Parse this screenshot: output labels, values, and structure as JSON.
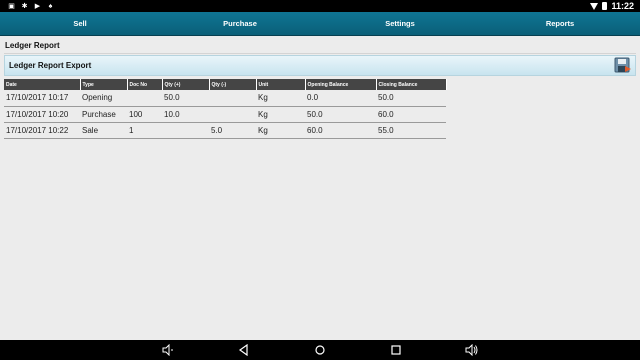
{
  "status": {
    "time": "11:22"
  },
  "tabs": [
    {
      "label": "Sell"
    },
    {
      "label": "Purchase"
    },
    {
      "label": "Settings"
    },
    {
      "label": "Reports"
    }
  ],
  "page": {
    "title": "Ledger Report",
    "export_label": "Ledger Report Export"
  },
  "table": {
    "headers": [
      "Date",
      "Type",
      "Doc No",
      "Qty (+)",
      "Qty (-)",
      "Unit",
      "Opening Balance",
      "Closing Balance"
    ],
    "rows": [
      [
        "17/10/2017 10:17",
        "Opening",
        "",
        "50.0",
        "",
        "Kg",
        "0.0",
        "50.0"
      ],
      [
        "17/10/2017 10:20",
        "Purchase",
        "100",
        "10.0",
        "",
        "Kg",
        "50.0",
        "60.0"
      ],
      [
        "17/10/2017 10:22",
        "Sale",
        "1",
        "",
        "5.0",
        "Kg",
        "60.0",
        "55.0"
      ]
    ]
  },
  "icons": {
    "export": "save-disk-icon",
    "nav": [
      "volume-down-icon",
      "back-icon",
      "home-icon",
      "recents-icon",
      "volume-up-icon"
    ]
  }
}
